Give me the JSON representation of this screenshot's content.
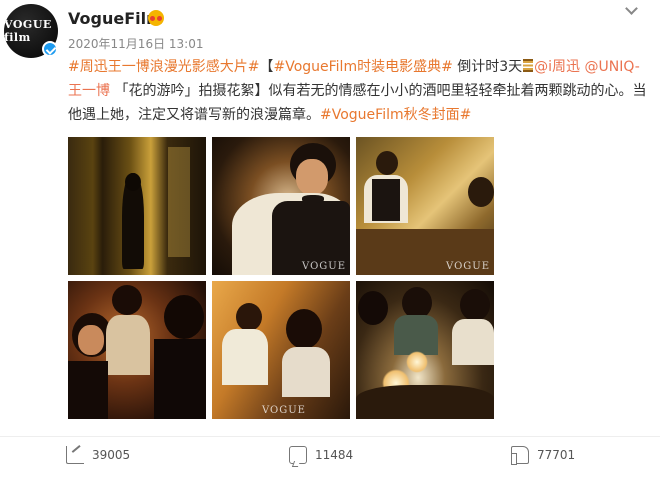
{
  "author": {
    "name": "VogueFilm",
    "avatar_label": "VOGUE film",
    "timestamp": "2020年11月16日 13:01"
  },
  "post": {
    "segments": [
      {
        "type": "tag",
        "text": "#周迅王一博浪漫光影感大片#"
      },
      {
        "type": "text",
        "text": "【"
      },
      {
        "type": "tag",
        "text": "#VogueFilm时装电影盛典#"
      },
      {
        "type": "text",
        "text": " 倒计时3天"
      },
      {
        "type": "icon",
        "name": "hourglass-icon"
      },
      {
        "type": "link",
        "text": "@i周迅"
      },
      {
        "type": "text",
        "text": " "
      },
      {
        "type": "link",
        "text": "@UNIQ-王一博"
      },
      {
        "type": "text",
        "text": " 「花的游吟」拍摄花絮】似有若无的情感在小小的酒吧里轻轻牵扯着两颗跳动的心。当他遇上她，注定又将谱写新的浪漫篇章。"
      },
      {
        "type": "tag",
        "text": "#VogueFilm秋冬封面#"
      }
    ]
  },
  "photos": [
    {
      "watermark": ""
    },
    {
      "watermark": "VOGUE"
    },
    {
      "watermark": "VOGUE"
    },
    {
      "watermark": ""
    },
    {
      "watermark": "VOGUE"
    },
    {
      "watermark": ""
    }
  ],
  "actions": {
    "share_count": "39005",
    "comment_count": "11484",
    "like_count": "77701"
  },
  "colors": {
    "tag": "#e8782f",
    "link": "#eb7350",
    "verified": "#1d9bf0"
  }
}
